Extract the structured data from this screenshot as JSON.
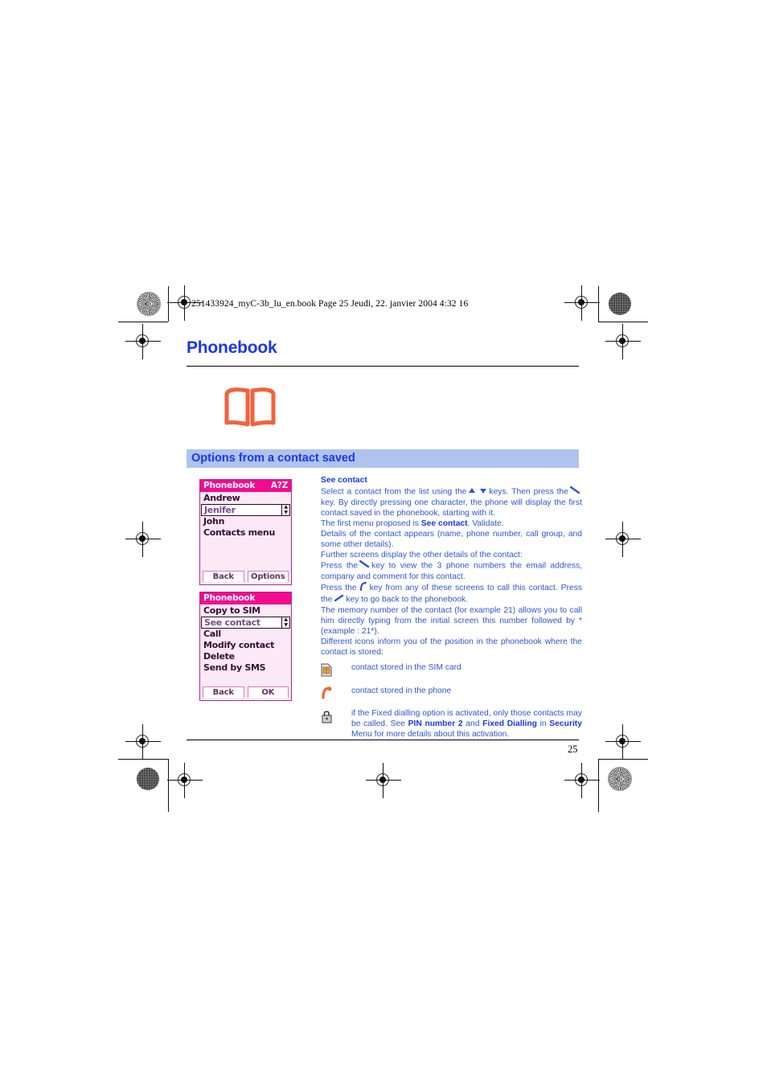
{
  "print_marks": {
    "file_stamp": "251433924_myC-3b_lu_en.book  Page 25  Jeudi, 22. janvier 2004  4:32 16"
  },
  "page": {
    "chapter_title": "Phonebook",
    "section_title": "Options from a contact saved",
    "page_number": "25",
    "book_icon_color": "#f4623a"
  },
  "phone_screens": [
    {
      "name": "contact-list-screen",
      "title": "Phonebook",
      "title_right": "A?Z",
      "rows": [
        {
          "label": "Andrew",
          "selected": false
        },
        {
          "label": "Jenifer",
          "selected": true
        },
        {
          "label": "John",
          "selected": false
        },
        {
          "label": "Contacts menu",
          "selected": false
        }
      ],
      "softkeys": [
        "Back",
        "Options"
      ]
    },
    {
      "name": "contact-options-screen",
      "title": "Phonebook",
      "title_right": "",
      "rows": [
        {
          "label": "Copy to SIM",
          "selected": false
        },
        {
          "label": "See contact",
          "selected": true
        },
        {
          "label": "Call",
          "selected": false
        },
        {
          "label": "Modify contact",
          "selected": false
        },
        {
          "label": "Delete",
          "selected": false
        },
        {
          "label": "Send by SMS",
          "selected": false
        }
      ],
      "softkeys": [
        "Back",
        "OK"
      ]
    }
  ],
  "body": {
    "sub_head": "See contact",
    "p1_a": "Select a contact from the list using the",
    "p1_b": "keys. Then press the",
    "p1_c": "key. By directly pressing one character, the phone will display the first contact saved in the phonebook, starting with it.",
    "p2_a": "The first menu proposed is",
    "p2_bold": "See contact",
    "p2_b": ". Validate.",
    "p3": "Details of the contact appears (name, phone number, call group, and some other details).",
    "p4": "Further screens display the other details of the contact:",
    "p5_a": "Press the",
    "p5_b": "key to view the 3 phone numbers the email address, company and comment for this contact.",
    "p6_a": "Press the",
    "p6_b": "key from any of these screens to call this contact. Press the",
    "p6_c": "key to go back to the phonebook.",
    "p7": "The memory number of the contact (for example 21) allows you to call him directly typing from the initial screen this number followed by * (example : 21*).",
    "p8": "Different icons inform you of the position in the phonebook where the contact is stored:",
    "icons": [
      {
        "icon_name": "sim-card-icon",
        "text": "contact stored in the SIM card"
      },
      {
        "icon_name": "phone-handset-icon",
        "text": "contact stored in the phone"
      },
      {
        "icon_name": "padlock-icon",
        "text_a": "if the Fixed dialling option is activated, only those contacts may be called. See",
        "text_bold1": "PIN number 2",
        "text_mid1": "and",
        "text_bold2": "Fixed Dialling",
        "text_mid2": "in",
        "text_bold3": "Security",
        "text_b": "Menu for more details about this activation."
      }
    ]
  }
}
